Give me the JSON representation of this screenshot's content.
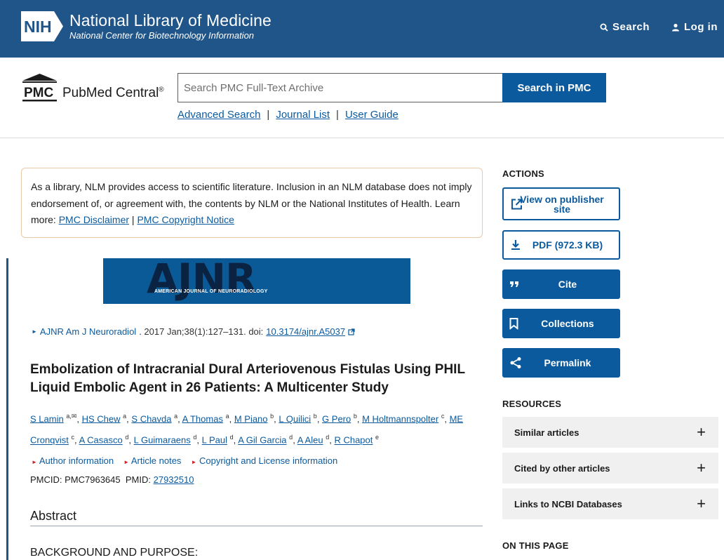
{
  "header": {
    "nih_badge": "NIH",
    "org_name": "National Library of Medicine",
    "org_subtitle": "National Center for Biotechnology Information",
    "search_label": "Search",
    "login_label": "Log in",
    "bg_color": "#20558a"
  },
  "pmc": {
    "logo_mark": "PMC",
    "name": "PubMed Central",
    "reg": "®",
    "search_placeholder": "Search PMC Full-Text Archive",
    "search_button": "Search in PMC",
    "links": [
      "Advanced Search",
      "Journal List",
      "User Guide"
    ],
    "separator": "|"
  },
  "disclaimer": {
    "text": "As a library, NLM provides access to scientific literature. Inclusion in an NLM database does not imply endorsement of, or agreement with, the contents by NLM or the National Institutes of Health.",
    "learn_more": "Learn more:",
    "link1": "PMC Disclaimer",
    "sep": "|",
    "link2": "PMC Copyright Notice"
  },
  "journal_banner": {
    "big": "AJNR",
    "small": "AMERICAN JOURNAL OF NEURORADIOLOGY"
  },
  "citation": {
    "journal": "AJNR Am J Neuroradiol",
    "details": ". 2017 Jan;38(1):127–131. doi:",
    "doi": "10.3174/ajnr.A5037"
  },
  "article": {
    "title": "Embolization of Intracranial Dural Arteriovenous Fistulas Using PHIL Liquid Embolic Agent in 26 Patients: A Multicenter Study",
    "authors": [
      {
        "name": "S Lamin",
        "sup": "a,✉"
      },
      {
        "name": "HS Chew",
        "sup": "a"
      },
      {
        "name": "S Chavda",
        "sup": "a"
      },
      {
        "name": "A Thomas",
        "sup": "a"
      },
      {
        "name": "M Piano",
        "sup": "b"
      },
      {
        "name": "L Quilici",
        "sup": "b"
      },
      {
        "name": "G Pero",
        "sup": "b"
      },
      {
        "name": "M Holtmannspolter",
        "sup": "c"
      },
      {
        "name": "ME Cronqvist",
        "sup": "c"
      },
      {
        "name": "A Casasco",
        "sup": "d"
      },
      {
        "name": "L Guimaraens",
        "sup": "d"
      },
      {
        "name": "L Paul",
        "sup": "d"
      },
      {
        "name": "A Gil Garcia",
        "sup": "d"
      },
      {
        "name": "A Aleu",
        "sup": "d"
      },
      {
        "name": "R Chapot",
        "sup": "e"
      }
    ],
    "info_links": [
      "Author information",
      "Article notes",
      "Copyright and License information"
    ],
    "pmcid_label": "PMCID: PMC7963645",
    "pmid_label": "PMID:",
    "pmid": "27932510",
    "abstract_heading": "Abstract",
    "background_heading": "BACKGROUND AND PURPOSE:"
  },
  "actions": {
    "heading": "ACTIONS",
    "view_publisher": "View on publisher site",
    "pdf": "PDF (972.3 KB)",
    "cite": "Cite",
    "collections": "Collections",
    "permalink": "Permalink"
  },
  "resources": {
    "heading": "RESOURCES",
    "items": [
      "Similar articles",
      "Cited by other articles",
      "Links to NCBI Databases"
    ]
  },
  "on_this_page": {
    "heading": "ON THIS PAGE"
  }
}
